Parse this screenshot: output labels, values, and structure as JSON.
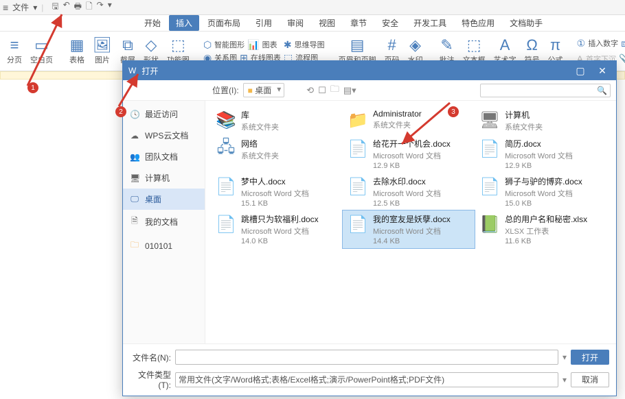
{
  "titlebar": {
    "file_label": "文件"
  },
  "menu": {
    "tabs": [
      "开始",
      "插入",
      "页面布局",
      "引用",
      "审阅",
      "视图",
      "章节",
      "安全",
      "开发工具",
      "特色应用",
      "文档助手"
    ],
    "active_index": 1
  },
  "ribbon": {
    "page_break": "分页",
    "blank_page": "空白页",
    "table": "表格",
    "picture": "图片",
    "screenshot": "截屏",
    "shapes": "形状",
    "function_chart": "功能图",
    "smart_shape": "智能图形",
    "chart": "图表",
    "online_chart": "在线图表",
    "relation": "关系图",
    "mindmap": "思维导图",
    "flowchart": "流程图",
    "header_footer": "页眉和页脚",
    "page_no": "页码",
    "watermark": "水印",
    "comment": "批注",
    "textbox": "文本框",
    "wordart": "艺术字",
    "symbol": "符号",
    "equation": "公式",
    "insert_number": "插入数字",
    "object": "对象",
    "drop_cap": "首字下沉",
    "attachment": "附件"
  },
  "dialog": {
    "title": "打开",
    "location_label": "位置(I):",
    "location_value": "桌面",
    "sidebar": {
      "recent": "最近访问",
      "wps_cloud": "WPS云文档",
      "team": "团队文档",
      "computer": "计算机",
      "desktop": "桌面",
      "documents": "我的文档",
      "folder1": "010101"
    },
    "files": [
      {
        "name": "库",
        "type": "系统文件夹",
        "size": "",
        "icon": "lib"
      },
      {
        "name": "Administrator",
        "type": "系统文件夹",
        "size": "",
        "icon": "folder"
      },
      {
        "name": "计算机",
        "type": "系统文件夹",
        "size": "",
        "icon": "pc"
      },
      {
        "name": "网络",
        "type": "系统文件夹",
        "size": "",
        "icon": "net"
      },
      {
        "name": "给花开一个机会.docx",
        "type": "Microsoft Word 文档",
        "size": "12.9 KB",
        "icon": "word"
      },
      {
        "name": "简历.docx",
        "type": "Microsoft Word 文档",
        "size": "12.9 KB",
        "icon": "word"
      },
      {
        "name": "梦中人.docx",
        "type": "Microsoft Word 文档",
        "size": "15.1 KB",
        "icon": "word"
      },
      {
        "name": "去除水印.docx",
        "type": "Microsoft Word 文档",
        "size": "12.5 KB",
        "icon": "word"
      },
      {
        "name": "狮子与驴的博弈.docx",
        "type": "Microsoft Word 文档",
        "size": "15.0 KB",
        "icon": "word"
      },
      {
        "name": "跳槽只为软福利.docx",
        "type": "Microsoft Word 文档",
        "size": "14.0 KB",
        "icon": "word"
      },
      {
        "name": "我的室友是妖孽.docx",
        "type": "Microsoft Word 文档",
        "size": "14.4 KB",
        "icon": "word",
        "selected": true
      },
      {
        "name": "总的用户名和秘密.xlsx",
        "type": "XLSX 工作表",
        "size": "11.6 KB",
        "icon": "xls"
      }
    ],
    "filename_label": "文件名(N):",
    "filetype_label": "文件类型(T):",
    "filetype_value": "常用文件(文字/Word格式;表格/Excel格式;演示/PowerPoint格式;PDF文件)",
    "open_btn": "打开",
    "cancel_btn": "取消"
  },
  "annotations": {
    "n1": "1",
    "n2": "2",
    "n3": "3"
  }
}
